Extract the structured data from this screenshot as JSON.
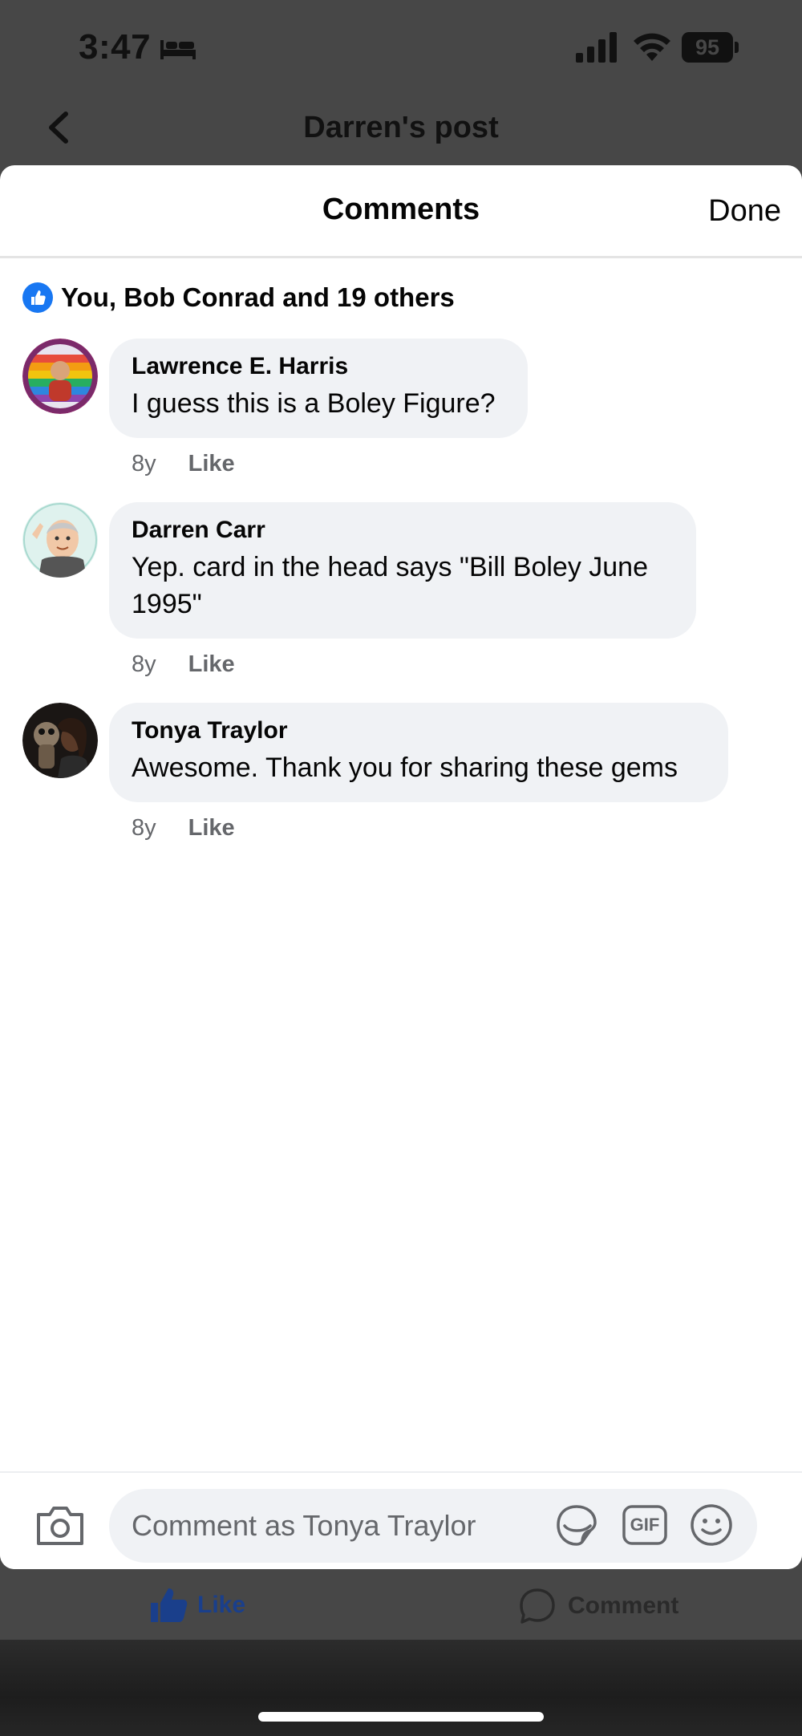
{
  "status_bar": {
    "time": "3:47",
    "battery": "95"
  },
  "nav": {
    "title": "Darren's post"
  },
  "sheet": {
    "title": "Comments",
    "done_label": "Done"
  },
  "reactions": {
    "summary": "You, Bob Conrad and 19 others"
  },
  "comments": [
    {
      "author": "Lawrence E. Harris",
      "text": "I guess this is a Boley Figure?",
      "time": "8y",
      "like_label": "Like"
    },
    {
      "author": "Darren Carr",
      "text": "Yep. card in the head says \"Bill Boley June 1995\"",
      "time": "8y",
      "like_label": "Like"
    },
    {
      "author": "Tonya Traylor",
      "text": "Awesome. Thank you for sharing these gems",
      "time": "8y",
      "like_label": "Like"
    }
  ],
  "composer": {
    "placeholder": "Comment as Tonya Traylor",
    "gif_label": "GIF"
  },
  "post_actions": {
    "like_label": "Like",
    "comment_label": "Comment"
  },
  "colors": {
    "accent": "#1877f2",
    "bubble": "#f0f2f5",
    "overlay": "#474747"
  }
}
